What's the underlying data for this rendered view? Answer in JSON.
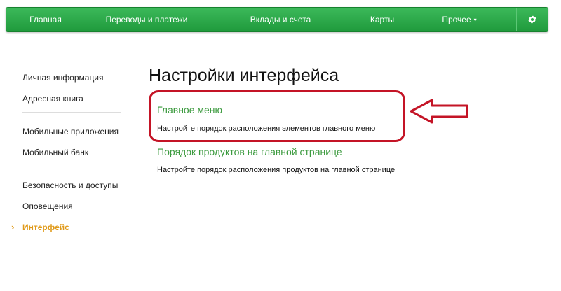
{
  "navbar": {
    "items": [
      {
        "label": "Главная"
      },
      {
        "label": "Переводы и платежи"
      },
      {
        "label": "Вклады и счета"
      },
      {
        "label": "Карты"
      },
      {
        "label": "Прочее",
        "caret": "▾"
      }
    ],
    "settings_icon": "gear-icon",
    "color": "#2ea84a"
  },
  "sidebar": {
    "groups": [
      [
        "Личная информация",
        "Адресная книга"
      ],
      [
        "Мобильные приложения",
        "Мобильный банк"
      ],
      [
        "Безопасность и доступы",
        "Оповещения",
        "Интерфейс"
      ]
    ],
    "active": "Интерфейс",
    "active_color": "#e09a19"
  },
  "main": {
    "title": "Настройки интерфейса",
    "sections": [
      {
        "link": "Главное меню",
        "description": "Настройте порядок расположения элементов главного меню"
      },
      {
        "link": "Порядок продуктов на главной странице",
        "description": "Настройте порядок расположения продуктов на главной странице"
      }
    ],
    "link_color": "#3b9a3e"
  },
  "annotation": {
    "highlight_color": "#c41426"
  }
}
